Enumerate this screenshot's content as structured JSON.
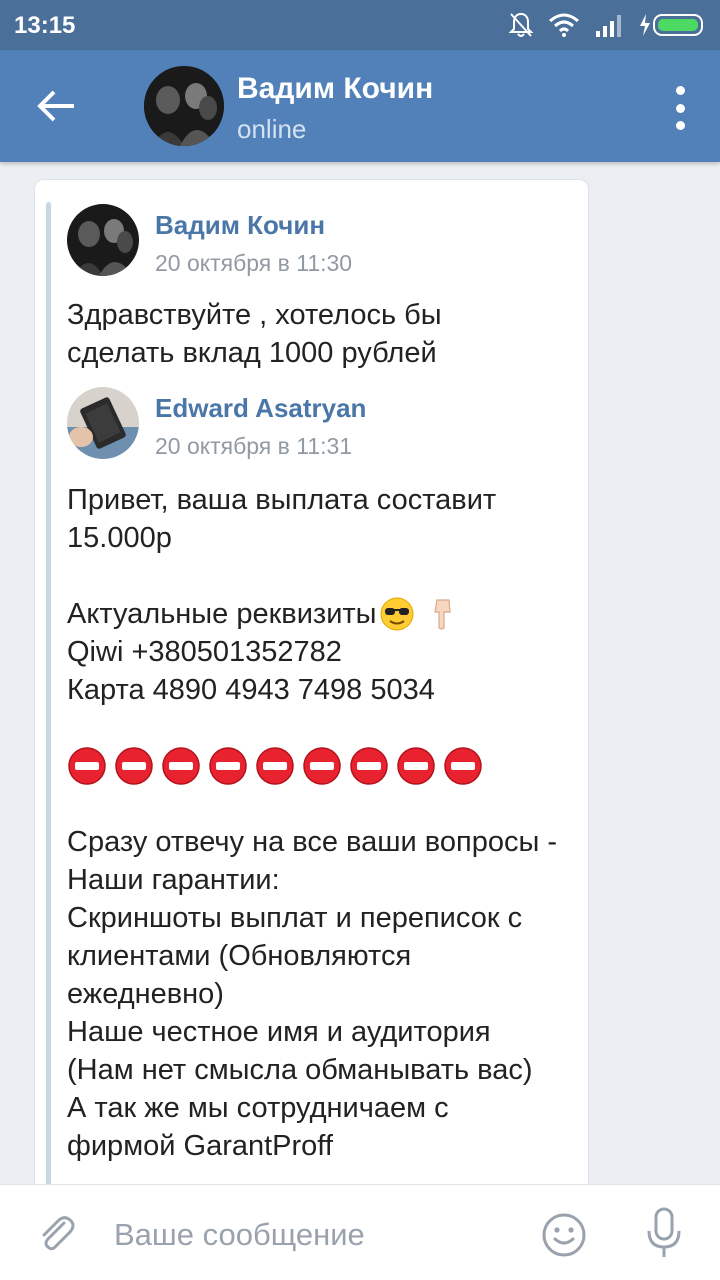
{
  "status_bar": {
    "time": "13:15",
    "icons": [
      "mute-bell-icon",
      "wifi-icon",
      "signal-icon",
      "battery-charging-icon"
    ]
  },
  "header": {
    "back_icon": "arrow-left-icon",
    "contact_name": "Вадим Кочин",
    "status": "online",
    "menu_icon": "more-vertical-icon"
  },
  "forwarded_messages": [
    {
      "author": "Вадим Кочин",
      "date": "20 октября в 11:30",
      "text": "Здравствуйте , хотелось бы сделать вклад 1000 рублей"
    },
    {
      "author": "Edward Asatryan",
      "date": "20 октября в 11:31",
      "text_lines": {
        "l1": "Привет, ваша выплата составит 15.000р",
        "l2": "Актуальные реквизиты",
        "l3": "Qiwi +380501352782",
        "l4": "Карта 4890 4943 7498 5034",
        "l5": "Сразу отвечу на все ваши вопросы - Наши гарантии:",
        "l6": "Скриншоты выплат и переписок с клиентами (Обновляются ежедневно)",
        "l7": "Наше честное имя и аудитория (Нам нет смысла обманывать вас)",
        "l8": "А так же мы сотрудничаем с фирмой GarantProff"
      },
      "emojis": [
        "sunglasses-emoji",
        "pointing-down-emoji"
      ],
      "stop_sign_count": 9
    }
  ],
  "input_bar": {
    "placeholder": "Ваше сообщение",
    "attach_icon": "paperclip-icon",
    "emoji_icon": "smile-icon",
    "mic_icon": "microphone-icon"
  },
  "colors": {
    "toolbar": "#5181b8",
    "status_bar": "#4a6f99",
    "link_name": "#4a76a8",
    "date_gray": "#919aa3",
    "chat_bg": "#ebeef2"
  }
}
